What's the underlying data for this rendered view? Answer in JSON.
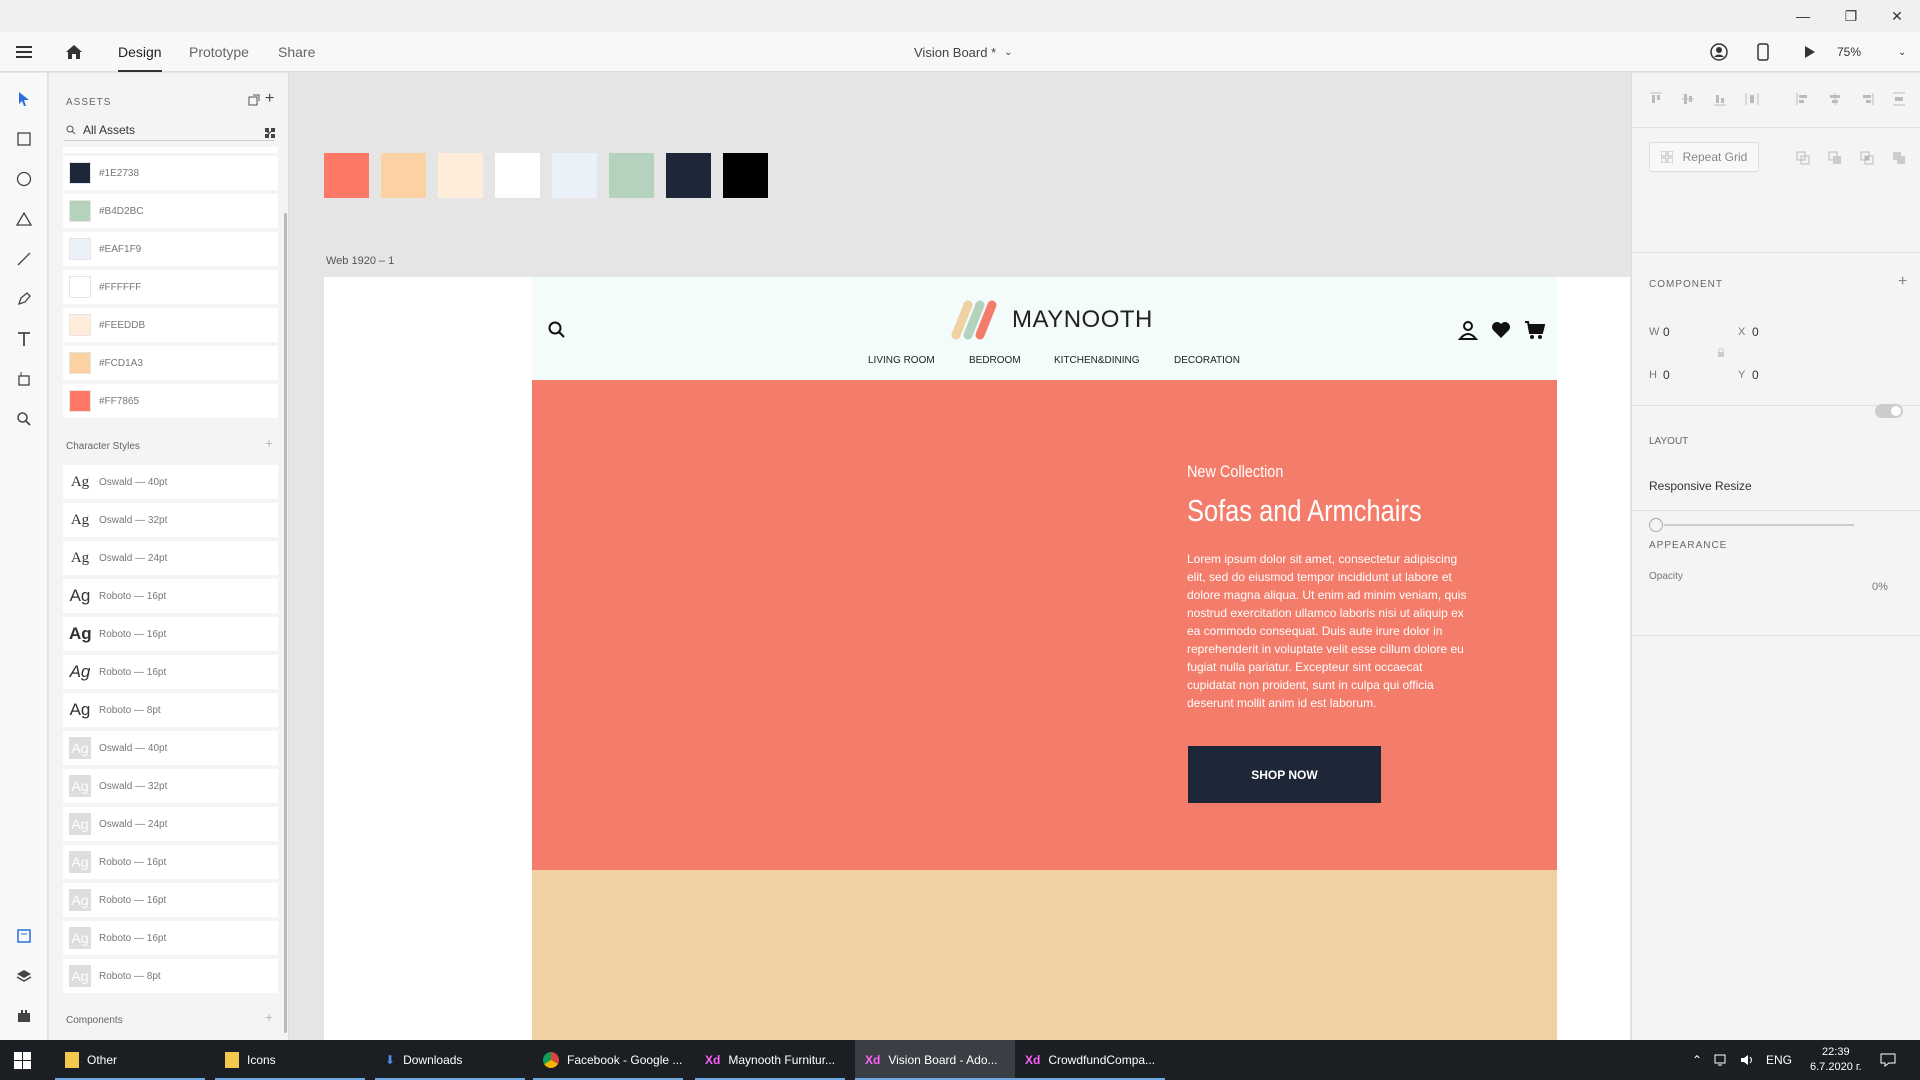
{
  "window": {
    "minimize": "—",
    "restore": "❐",
    "close": "✕"
  },
  "appbar": {
    "tabs": [
      "Design",
      "Prototype",
      "Share"
    ],
    "doc_title": "Vision Board *",
    "zoom": "75%"
  },
  "assets": {
    "title": "ASSETS",
    "filter": "All Assets",
    "colors": [
      {
        "hex": "#1E2738",
        "value": "#1e2738"
      },
      {
        "hex": "#B4D2BC",
        "value": "#b4d2bc"
      },
      {
        "hex": "#EAF1F9",
        "value": "#eaf1f9"
      },
      {
        "hex": "#FFFFFF",
        "value": "#ffffff"
      },
      {
        "hex": "#FEEDDB",
        "value": "#feeddb"
      },
      {
        "hex": "#FCD1A3",
        "value": "#fcd1a3"
      },
      {
        "hex": "#FF7865",
        "value": "#ff7865"
      }
    ],
    "char_title": "Character Styles",
    "char_styles": [
      {
        "ag": "Ag",
        "label": "Oswald — 40pt"
      },
      {
        "ag": "Ag",
        "label": "Oswald — 32pt"
      },
      {
        "ag": "Ag",
        "label": "Oswald — 24pt"
      },
      {
        "ag": "Ag",
        "label": "Roboto — 16pt"
      },
      {
        "ag": "Ag",
        "label": "Roboto — 16pt"
      },
      {
        "ag": "Ag",
        "label": "Roboto — 16pt"
      },
      {
        "ag": "Ag",
        "label": "Roboto — 8pt"
      },
      {
        "ag": "Ag",
        "label": "Oswald — 40pt"
      },
      {
        "ag": "Ag",
        "label": "Oswald — 32pt"
      },
      {
        "ag": "Ag",
        "label": "Oswald — 24pt"
      },
      {
        "ag": "Ag",
        "label": "Roboto — 16pt"
      },
      {
        "ag": "Ag",
        "label": "Roboto — 16pt"
      },
      {
        "ag": "Ag",
        "label": "Roboto — 16pt"
      },
      {
        "ag": "Ag",
        "label": "Roboto — 8pt"
      }
    ],
    "components_title": "Components"
  },
  "canvas": {
    "palette": [
      "#ff7865",
      "#fcd1a3",
      "#feeddb",
      "#ffffff",
      "#eaf1f9",
      "#b4d2bc",
      "#1e2738",
      "#000000"
    ],
    "artboard_label": "Web 1920 – 1"
  },
  "site": {
    "brand": "MAYNOOTH",
    "nav": [
      "LIVING ROOM",
      "BEDROOM",
      "KITCHEN&DINING",
      "DECORATION"
    ],
    "hero_kicker": "New Collection",
    "hero_title": "Sofas and Armchairs",
    "hero_body": "Lorem ipsum dolor sit amet, consectetur adipiscing elit, sed do eiusmod tempor incididunt ut labore et dolore magna aliqua. Ut enim ad minim veniam, quis nostrud exercitation ullamco laboris nisi ut aliquip ex ea commodo consequat. Duis aute irure dolor in reprehenderit in voluptate velit esse cillum dolore eu fugiat nulla pariatur. Excepteur sint occaecat cupidatat non proident, sunt in culpa qui officia deserunt mollit anim id est laborum.",
    "cta": "SHOP NOW",
    "hero_color": "#f47c6a",
    "band_color": "#f0d1a3"
  },
  "inspector": {
    "repeat_grid": "Repeat Grid",
    "component_title": "COMPONENT",
    "w_label": "W",
    "w_value": "0",
    "h_label": "H",
    "h_value": "0",
    "x_label": "X",
    "x_value": "0",
    "y_label": "Y",
    "y_value": "0",
    "layout_title": "LAYOUT",
    "responsive_resize": "Responsive Resize",
    "appearance_title": "APPEARANCE",
    "opacity_label": "Opacity",
    "opacity_value": "0%"
  },
  "taskbar": {
    "items": [
      "Other",
      "Icons",
      "Downloads",
      "Facebook - Google ...",
      "Maynooth Furnitur...",
      "Vision Board - Ado...",
      "CrowdfundCompa..."
    ],
    "lang": "ENG",
    "time": "22:39",
    "date": "6.7.2020 г."
  }
}
